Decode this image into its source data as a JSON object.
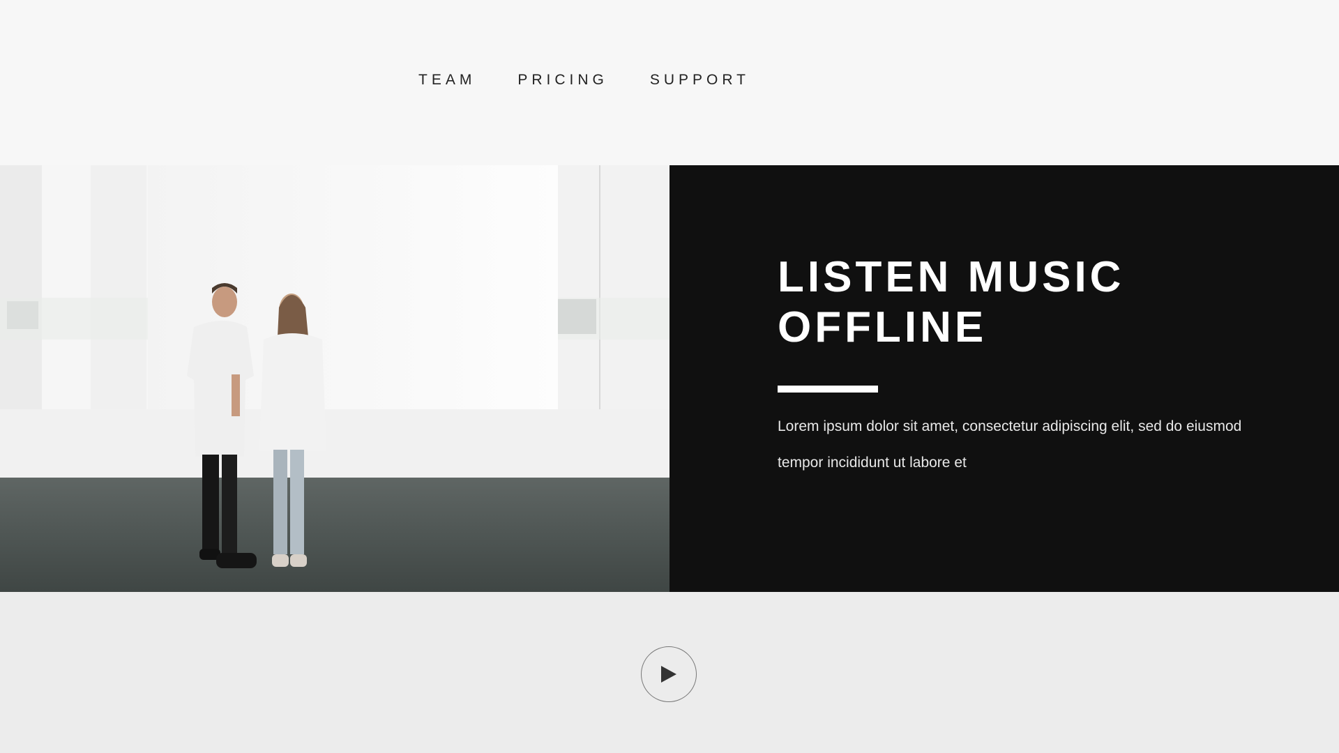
{
  "nav": {
    "items": [
      {
        "label": "TEAM"
      },
      {
        "label": "PRICING"
      },
      {
        "label": "SUPPORT"
      }
    ]
  },
  "hero": {
    "headline_line1": "LISTEN MUSIC",
    "headline_line2": "OFFLINE",
    "body": "Lorem ipsum dolor sit amet, consectetur adipiscing elit, sed do eiusmod tempor incididunt ut labore et",
    "panel_color": "#101010"
  },
  "media": {
    "play_icon": "play-icon"
  }
}
